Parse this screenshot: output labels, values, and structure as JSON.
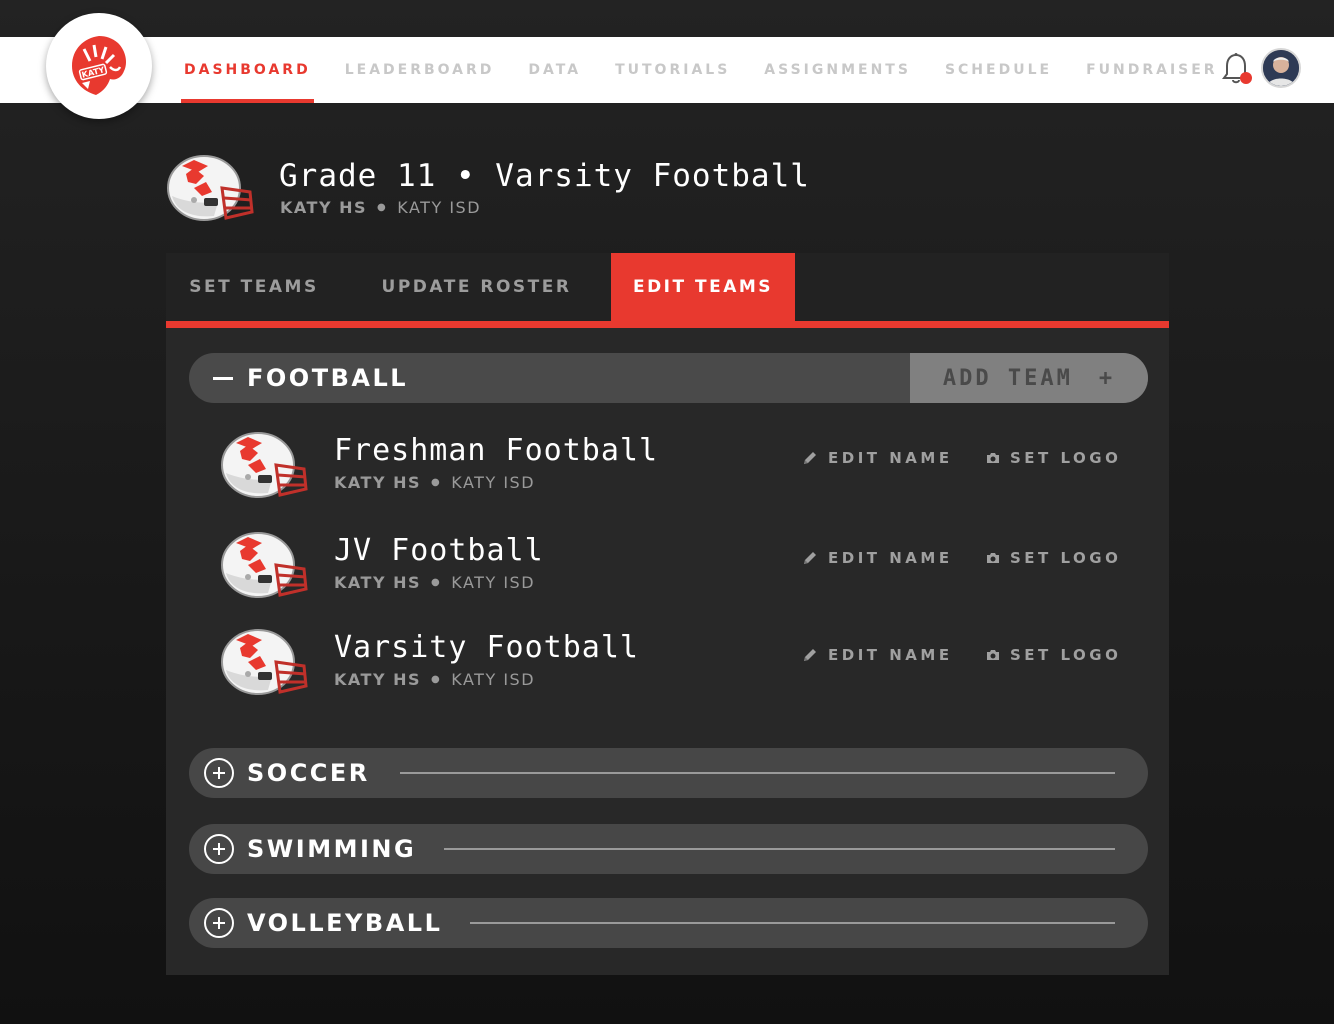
{
  "nav": {
    "items": [
      {
        "label": "DASHBOARD",
        "active": true
      },
      {
        "label": "LEADERBOARD",
        "active": false
      },
      {
        "label": "DATA",
        "active": false
      },
      {
        "label": "TUTORIALS",
        "active": false
      },
      {
        "label": "ASSIGNMENTS",
        "active": false
      },
      {
        "label": "SCHEDULE",
        "active": false
      },
      {
        "label": "FUNDRAISER",
        "active": false
      }
    ],
    "logo_text": "KATY",
    "notification_icon": "bell-icon",
    "has_notification": true
  },
  "header": {
    "title": "Grade 11 • Varsity Football",
    "school": "KATY HS",
    "district": "KATY ISD"
  },
  "tabs": [
    {
      "label": "SET TEAMS",
      "active": false
    },
    {
      "label": "UPDATE ROSTER",
      "active": false
    },
    {
      "label": "EDIT TEAMS",
      "active": true
    }
  ],
  "categories": {
    "football": {
      "name": "FOOTBALL",
      "expanded": true,
      "add_team_label": "ADD TEAM",
      "add_team_icon": "+",
      "teams": [
        {
          "name": "Freshman Football",
          "school": "KATY HS",
          "district": "KATY ISD"
        },
        {
          "name": "JV Football",
          "school": "KATY HS",
          "district": "KATY ISD"
        },
        {
          "name": "Varsity Football",
          "school": "KATY HS",
          "district": "KATY ISD"
        }
      ]
    },
    "collapsed": [
      {
        "name": "SOCCER"
      },
      {
        "name": "SWIMMING"
      },
      {
        "name": "VOLLEYBALL"
      }
    ]
  },
  "actions": {
    "edit_name_label": "EDIT NAME",
    "set_logo_label": "SET LOGO",
    "edit_icon": "pencil-icon",
    "logo_icon": "camera-icon"
  },
  "colors": {
    "accent": "#e8392f",
    "panel": "#282828",
    "bar": "#474747",
    "add_team_bg": "#808080"
  }
}
